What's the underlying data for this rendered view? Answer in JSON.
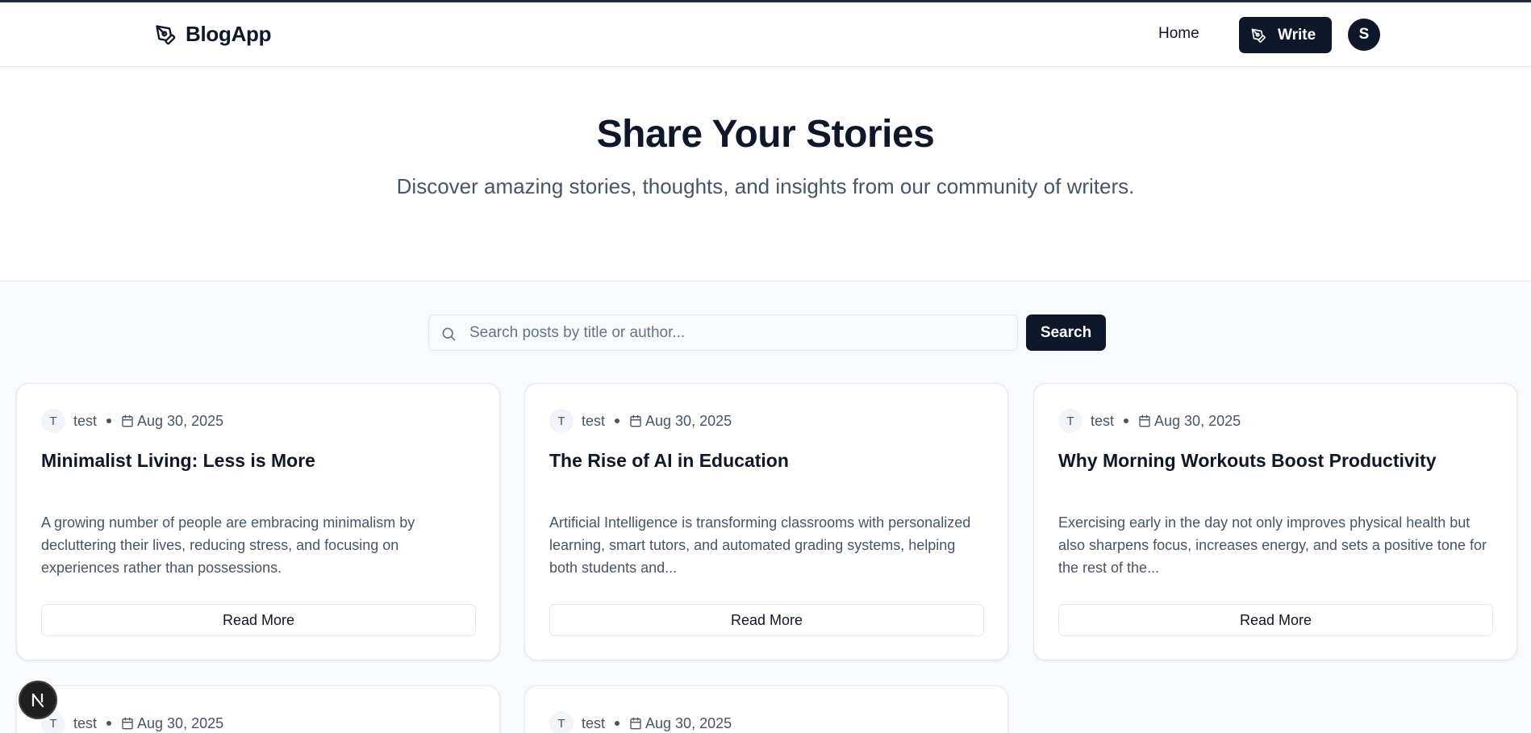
{
  "header": {
    "brand_name": "BlogApp",
    "nav_home": "Home",
    "write_label": "Write",
    "avatar_initial": "S"
  },
  "hero": {
    "title": "Share Your Stories",
    "subtitle": "Discover amazing stories, thoughts, and insights from our community of writers."
  },
  "search": {
    "placeholder": "Search posts by title or author...",
    "value": "",
    "button_label": "Search"
  },
  "posts": [
    {
      "avatar_initial": "T",
      "author": "test",
      "date": "Aug 30, 2025",
      "title": "Minimalist Living: Less is More",
      "excerpt": "A growing number of people are embracing minimalism by decluttering their lives, reducing stress, and focusing on experiences rather than possessions.",
      "read_more": "Read More"
    },
    {
      "avatar_initial": "T",
      "author": "test",
      "date": "Aug 30, 2025",
      "title": "The Rise of AI in Education",
      "excerpt": "Artificial Intelligence is transforming classrooms with personalized learning, smart tutors, and automated grading systems, helping both students and...",
      "read_more": "Read More"
    },
    {
      "avatar_initial": "T",
      "author": "test",
      "date": "Aug 30, 2025",
      "title": "Why Morning Workouts Boost Productivity",
      "excerpt": "Exercising early in the day not only improves physical health but also sharpens focus, increases energy, and sets a positive tone for the rest of the...",
      "read_more": "Read More"
    },
    {
      "avatar_initial": "T",
      "author": "test",
      "date": "Aug 30, 2025"
    },
    {
      "avatar_initial": "T",
      "author": "test",
      "date": "Aug 30, 2025"
    }
  ],
  "icons": {
    "logo": "pen-tool-icon",
    "write": "pen-tool-icon",
    "search": "search-icon",
    "date": "calendar-icon",
    "dev_badge": "nextjs-icon"
  },
  "colors": {
    "primary": "#0f172a",
    "muted_text": "#475569",
    "border": "#e2e8f0",
    "page_bg": "#f8fafc"
  }
}
